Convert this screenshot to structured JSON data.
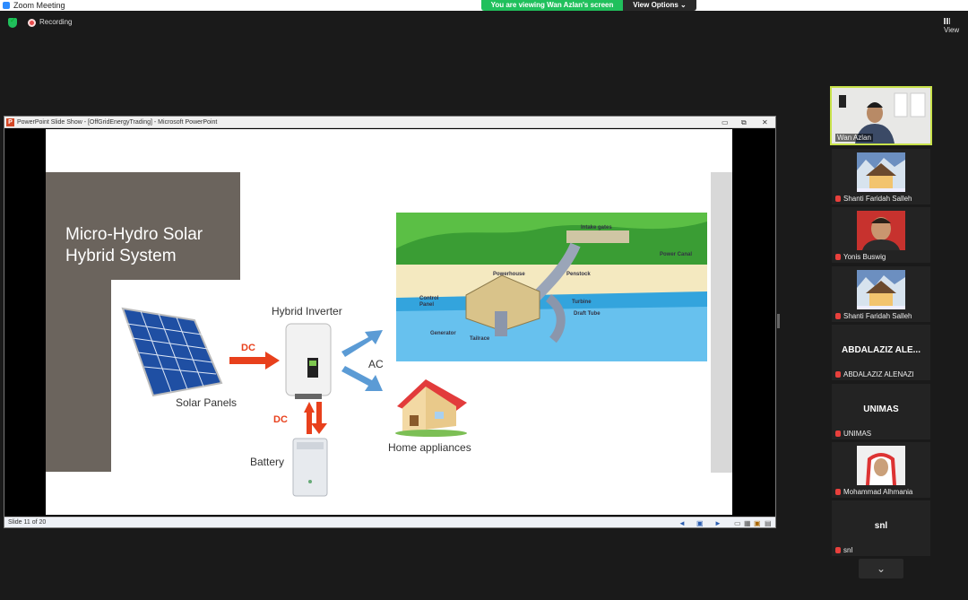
{
  "app": {
    "title": "Zoom Meeting",
    "viewing_banner": "You are viewing Wan Azlan's screen",
    "view_options": "View Options ⌄",
    "recording": "Recording",
    "view_label": "View"
  },
  "powerpoint": {
    "window_title": "PowerPoint Slide Show - [OffGridEnergyTrading] - Microsoft PowerPoint",
    "status": "Slide 11 of 20"
  },
  "slide": {
    "title_line1": "Micro-Hydro Solar",
    "title_line2": "Hybrid System",
    "solar_panels": "Solar Panels",
    "hybrid_inverter": "Hybrid Inverter",
    "battery": "Battery",
    "home_appliances": "Home appliances",
    "dc1": "DC",
    "dc2": "DC",
    "ac": "AC",
    "hydro_labels": {
      "intake": "Intake gates",
      "power_canal": "Power Canal",
      "powerhouse": "Powerhouse",
      "penstock": "Penstock",
      "control": "Control",
      "panel": "Panel",
      "turbine": "Turbine",
      "draft_tube": "Draft Tube",
      "generator": "Generator",
      "tailrace": "Tailrace"
    }
  },
  "participants": [
    {
      "name": "Wan Azlan",
      "type": "video"
    },
    {
      "name": "Shanti Faridah Salleh",
      "type": "photo"
    },
    {
      "name": "Yonis Buswig",
      "type": "photo"
    },
    {
      "name": "Shanti Faridah Salleh",
      "type": "photo"
    },
    {
      "name": "ABDALAZIZ ALENAZI",
      "display": "ABDALAZIZ ALE...",
      "type": "text"
    },
    {
      "name": "UNIMAS",
      "display": "UNIMAS",
      "type": "text"
    },
    {
      "name": "Mohammad Alhmania",
      "type": "photo"
    },
    {
      "name": "snl",
      "display": "snl",
      "type": "text"
    }
  ],
  "colors": {
    "accent_green": "#20c05c",
    "slide_brown": "#6b645d",
    "arrow_red": "#e8401c",
    "arrow_blue": "#5b9bd5"
  }
}
